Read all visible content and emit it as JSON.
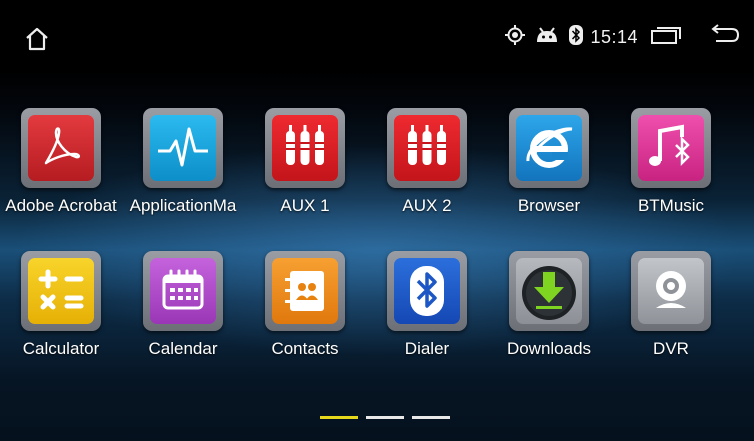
{
  "status_bar": {
    "time": "15:14",
    "icons": [
      "home-icon",
      "gps-icon",
      "android-debug-icon",
      "bluetooth-icon",
      "recent-apps-icon",
      "back-icon"
    ]
  },
  "apps": [
    {
      "label": "Adobe Acrobat",
      "icon": "adobe-acrobat-icon",
      "color": "#d8262b"
    },
    {
      "label": "ApplicationMa",
      "icon": "application-manager-icon",
      "color": "#17a8e3"
    },
    {
      "label": "AUX 1",
      "icon": "aux-icon",
      "color": "#e01e25"
    },
    {
      "label": "AUX 2",
      "icon": "aux-icon",
      "color": "#e01e25"
    },
    {
      "label": "Browser",
      "icon": "browser-icon",
      "color": "#1d93d8"
    },
    {
      "label": "BTMusic",
      "icon": "bt-music-icon",
      "color": "#e0389a"
    },
    {
      "label": "Calculator",
      "icon": "calculator-icon",
      "color": "#f2c514"
    },
    {
      "label": "Calendar",
      "icon": "calendar-icon",
      "color": "#b04ec9"
    },
    {
      "label": "Contacts",
      "icon": "contacts-icon",
      "color": "#f08a16"
    },
    {
      "label": "Dialer",
      "icon": "dialer-icon",
      "color": "#1e5fcf"
    },
    {
      "label": "Downloads",
      "icon": "downloads-icon",
      "color": "#9ea3a8"
    },
    {
      "label": "DVR",
      "icon": "dvr-icon",
      "color": "#a9adb2"
    }
  ],
  "pager": {
    "pages": 3,
    "current": 1
  }
}
